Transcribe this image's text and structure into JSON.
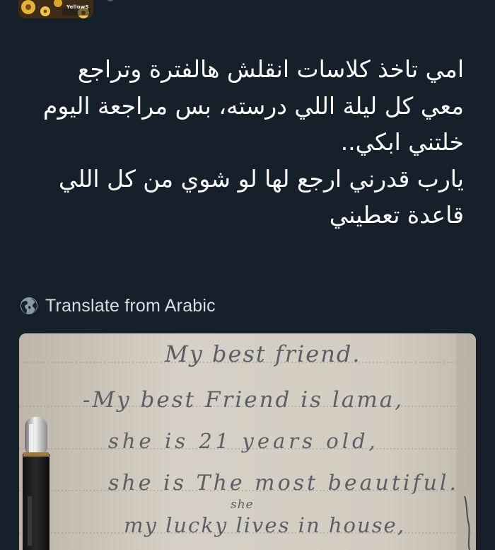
{
  "author": {
    "avatar_icon": "avatar-icon",
    "avatar_mark": "YellowS"
  },
  "tweet": {
    "lines": [
      "امي تاخذ كلاسات انقلش هالفترة وتراجع",
      "معي كل ليلة اللي درسته، بس مراجعة اليوم",
      "خلتني ابكي..",
      "يارب قدرني ارجع لها لو شوي من كل اللي",
      "قاعدة تعطيني"
    ],
    "text_color": "#ffffff"
  },
  "translate": {
    "icon": "globe-icon",
    "label": "Translate from Arabic"
  },
  "media": {
    "handwriting": [
      "My best friend.",
      "-My best Friend is lama,",
      "she is 21 years old,",
      "she is The most beautiful.",
      "my lucky lives in house,"
    ],
    "handwriting_insert": "she"
  },
  "colors": {
    "background": "#15202b",
    "secondary_text": "#d9dde2",
    "paper": "#cfc9bd",
    "ink": "#5d5d68"
  }
}
